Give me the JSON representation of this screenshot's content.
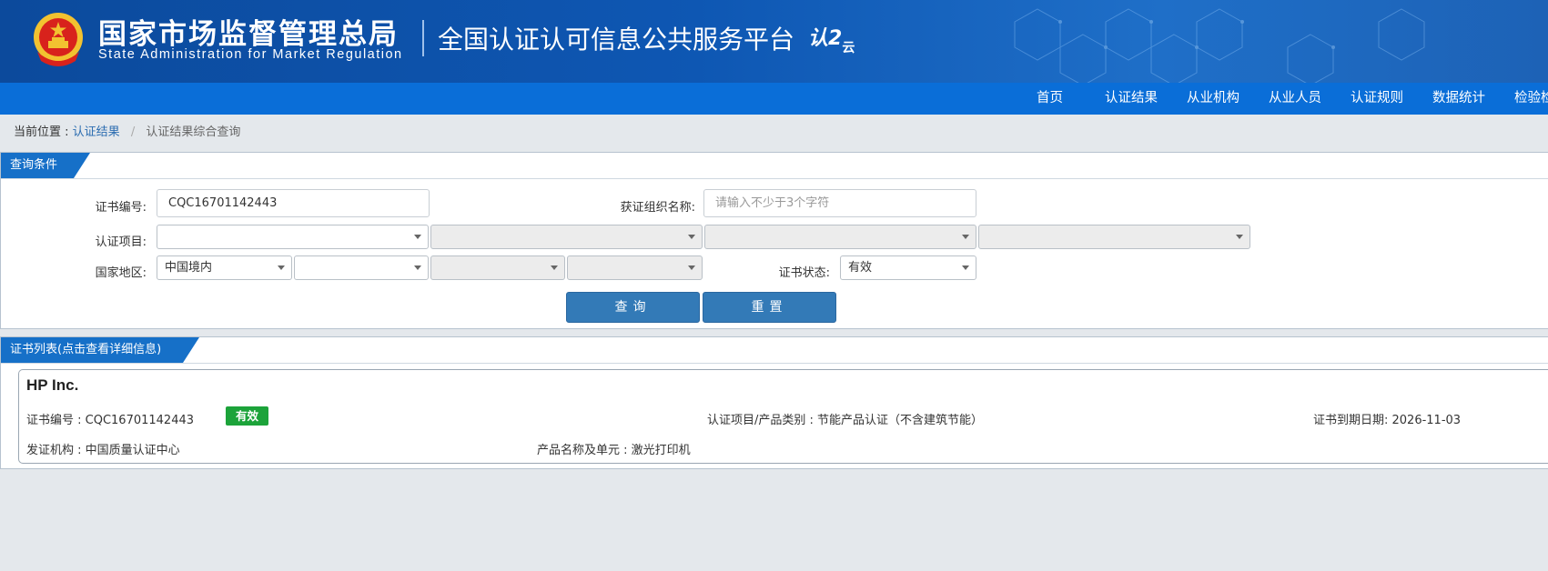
{
  "header": {
    "org_name_cn": "国家市场监督管理总局",
    "org_name_en": "State Administration  for  Market Regulation",
    "platform_title": "全国认证认可信息公共服务平台",
    "brand_logo_main": "认2",
    "brand_logo_sub": "云",
    "brand_color": "#0c4a9c"
  },
  "nav": {
    "items": [
      "首页",
      "认证结果",
      "从业机构",
      "从业人员",
      "认证规则",
      "数据统计",
      "检验检"
    ]
  },
  "breadcrumb": {
    "prefix": "当前位置 :",
    "link": "认证结果",
    "separator": "/",
    "current": "认证结果综合查询"
  },
  "query_panel": {
    "tab_label": "查询条件",
    "cert_no_label": "证书编号:",
    "cert_no_value": "CQC16701142443",
    "org_name_label": "获证组织名称:",
    "org_name_placeholder": "请输入不少于3个字符",
    "project_label": "认证项目:",
    "region_label": "国家地区:",
    "region_value": "中国境内",
    "status_label": "证书状态:",
    "status_value": "有效",
    "query_button": "查询",
    "reset_button": "重置"
  },
  "results_panel": {
    "tab_label": "证书列表(点击查看详细信息)",
    "card": {
      "title": "HP Inc.",
      "cert_no": "证书编号 : CQC16701142443",
      "status_badge": "有效",
      "status_color": "#1ca33a",
      "project": "认证项目/产品类别 : 节能产品认证（不含建筑节能）",
      "expiry": "证书到期日期: 2026-11-03",
      "issuer": "发证机构 : 中国质量认证中心",
      "product": "产品名称及单元 : 激光打印机"
    }
  }
}
